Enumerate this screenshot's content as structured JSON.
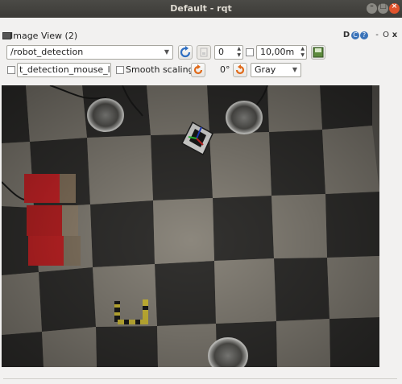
{
  "window": {
    "title": "Default - rqt"
  },
  "plugin": {
    "title": "Image View (2)",
    "header_buttons": {
      "d": "D",
      "c": "C",
      "help": "?",
      "minimize": "-",
      "float": "O",
      "close": "x"
    }
  },
  "toolbar": {
    "topic": "/robot_detection",
    "refresh_icon": "refresh-icon",
    "zoom_icon": "zoom-icon",
    "spin_value": "0",
    "smooth_value": "10,00m",
    "save_icon": "save-icon",
    "mouse_topic": "t_detection_mouse_left",
    "smooth_scaling_label": "Smooth scaling",
    "rotate_icon": "rotate-icon",
    "rotation_label": "0°",
    "rotate_ccw_icon": "rotate-ccw-icon",
    "colormap": "Gray"
  },
  "colors": {
    "titlebar": "#3c3b37",
    "close": "#e0532c",
    "red_box": "#d8262a",
    "floor_light": "#8a857c",
    "floor_dark": "#3a3937"
  }
}
